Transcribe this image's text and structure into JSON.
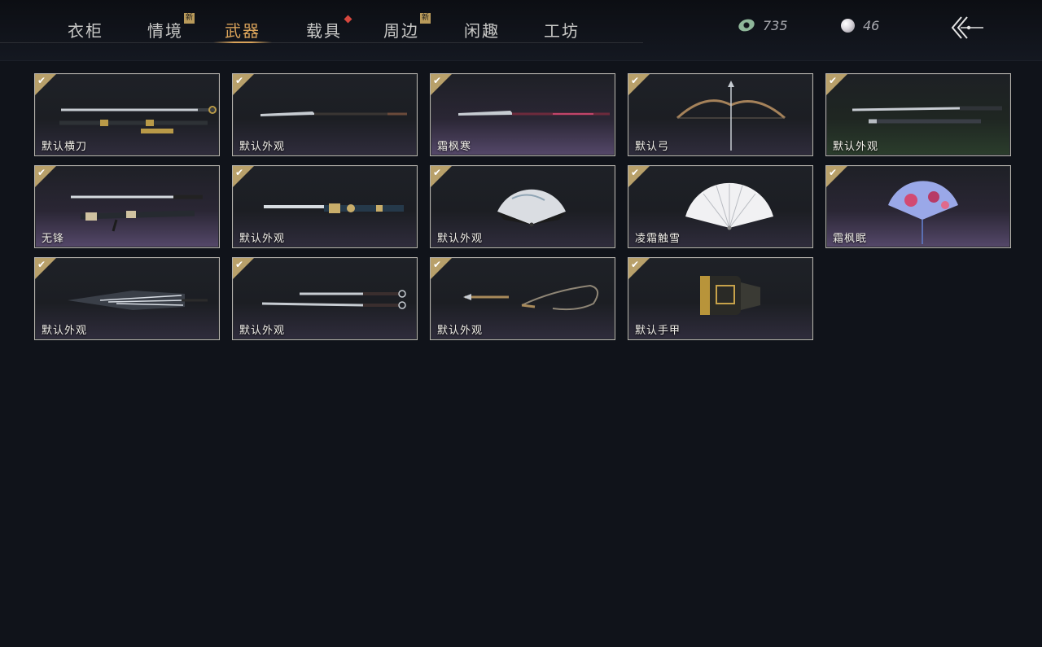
{
  "tabs": [
    {
      "label": "衣柜",
      "active": false,
      "badge": null
    },
    {
      "label": "情境",
      "active": false,
      "badge": "新"
    },
    {
      "label": "武器",
      "active": true,
      "badge": null
    },
    {
      "label": "载具",
      "active": false,
      "badge": "dot"
    },
    {
      "label": "周边",
      "active": false,
      "badge": "新"
    },
    {
      "label": "闲趣",
      "active": false,
      "badge": null
    },
    {
      "label": "工坊",
      "active": false,
      "badge": null
    }
  ],
  "currency": {
    "jade": {
      "icon": "jade-coin-icon",
      "value": "735"
    },
    "pearl": {
      "icon": "pearl-icon",
      "value": "46"
    }
  },
  "back_button": {
    "icon": "back-arrow-icon"
  },
  "items": [
    {
      "label": "默认横刀",
      "icon": "dao-sabre-icon",
      "owned": true
    },
    {
      "label": "默认外观",
      "icon": "spear-icon",
      "owned": true
    },
    {
      "label": "霜枫寒",
      "icon": "red-spear-icon",
      "owned": true
    },
    {
      "label": "默认弓",
      "icon": "bow-icon",
      "owned": true
    },
    {
      "label": "默认外观",
      "icon": "twin-blades-icon",
      "owned": true
    },
    {
      "label": "无锋",
      "icon": "ornate-sword-icon",
      "owned": true
    },
    {
      "label": "默认外观",
      "icon": "ornate-blade-icon",
      "owned": true
    },
    {
      "label": "默认外观",
      "icon": "painted-fan-icon",
      "owned": true
    },
    {
      "label": "凌霜触雪",
      "icon": "white-fan-icon",
      "owned": true
    },
    {
      "label": "霜枫眠",
      "icon": "floral-fan-icon",
      "owned": true
    },
    {
      "label": "默认外观",
      "icon": "umbrella-icon",
      "owned": true
    },
    {
      "label": "默认外观",
      "icon": "dual-swords-icon",
      "owned": true
    },
    {
      "label": "默认外观",
      "icon": "rope-dart-icon",
      "owned": true
    },
    {
      "label": "默认手甲",
      "icon": "gauntlet-icon",
      "owned": true
    }
  ],
  "colors": {
    "background": "#10131a",
    "accent_gold": "#d9a35a",
    "check_corner": "#b8a06a",
    "card_border": "#b6b3ad",
    "badge_red": "#d6473e"
  }
}
